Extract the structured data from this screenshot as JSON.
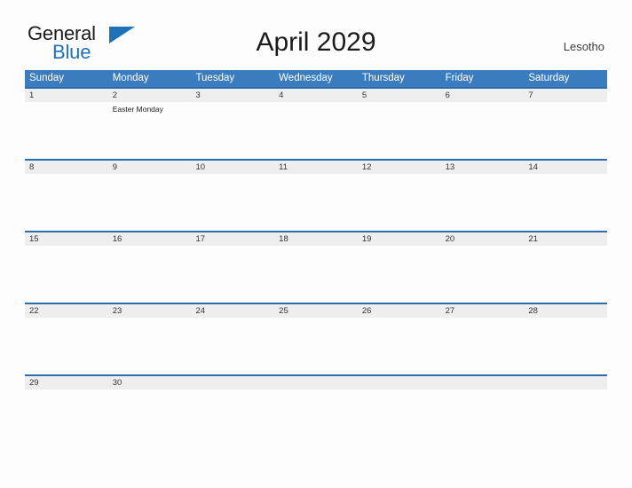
{
  "brand": {
    "name_part1": "General",
    "name_part2": "Blue",
    "triangle_icon": "blue-triangle-icon",
    "accent_color": "#1f72b8"
  },
  "header": {
    "title": "April 2029",
    "locale": "Lesotho"
  },
  "theme": {
    "weekday_header_bg": "#3a7cbe",
    "weekday_header_text": "#ffffff",
    "week_divider": "#2a6cae",
    "day_band_bg": "#eeeeee",
    "page_bg": "#fdfdfd",
    "day_number_text": "#333333"
  },
  "calendar": {
    "weekdays": [
      "Sunday",
      "Monday",
      "Tuesday",
      "Wednesday",
      "Thursday",
      "Friday",
      "Saturday"
    ],
    "weeks": [
      {
        "days": [
          {
            "num": "1",
            "event": ""
          },
          {
            "num": "2",
            "event": "Easter Monday"
          },
          {
            "num": "3",
            "event": ""
          },
          {
            "num": "4",
            "event": ""
          },
          {
            "num": "5",
            "event": ""
          },
          {
            "num": "6",
            "event": ""
          },
          {
            "num": "7",
            "event": ""
          }
        ]
      },
      {
        "days": [
          {
            "num": "8",
            "event": ""
          },
          {
            "num": "9",
            "event": ""
          },
          {
            "num": "10",
            "event": ""
          },
          {
            "num": "11",
            "event": ""
          },
          {
            "num": "12",
            "event": ""
          },
          {
            "num": "13",
            "event": ""
          },
          {
            "num": "14",
            "event": ""
          }
        ]
      },
      {
        "days": [
          {
            "num": "15",
            "event": ""
          },
          {
            "num": "16",
            "event": ""
          },
          {
            "num": "17",
            "event": ""
          },
          {
            "num": "18",
            "event": ""
          },
          {
            "num": "19",
            "event": ""
          },
          {
            "num": "20",
            "event": ""
          },
          {
            "num": "21",
            "event": ""
          }
        ]
      },
      {
        "days": [
          {
            "num": "22",
            "event": ""
          },
          {
            "num": "23",
            "event": ""
          },
          {
            "num": "24",
            "event": ""
          },
          {
            "num": "25",
            "event": ""
          },
          {
            "num": "26",
            "event": ""
          },
          {
            "num": "27",
            "event": ""
          },
          {
            "num": "28",
            "event": ""
          }
        ]
      },
      {
        "days": [
          {
            "num": "29",
            "event": ""
          },
          {
            "num": "30",
            "event": ""
          },
          {
            "num": "",
            "event": ""
          },
          {
            "num": "",
            "event": ""
          },
          {
            "num": "",
            "event": ""
          },
          {
            "num": "",
            "event": ""
          },
          {
            "num": "",
            "event": ""
          }
        ]
      }
    ]
  }
}
